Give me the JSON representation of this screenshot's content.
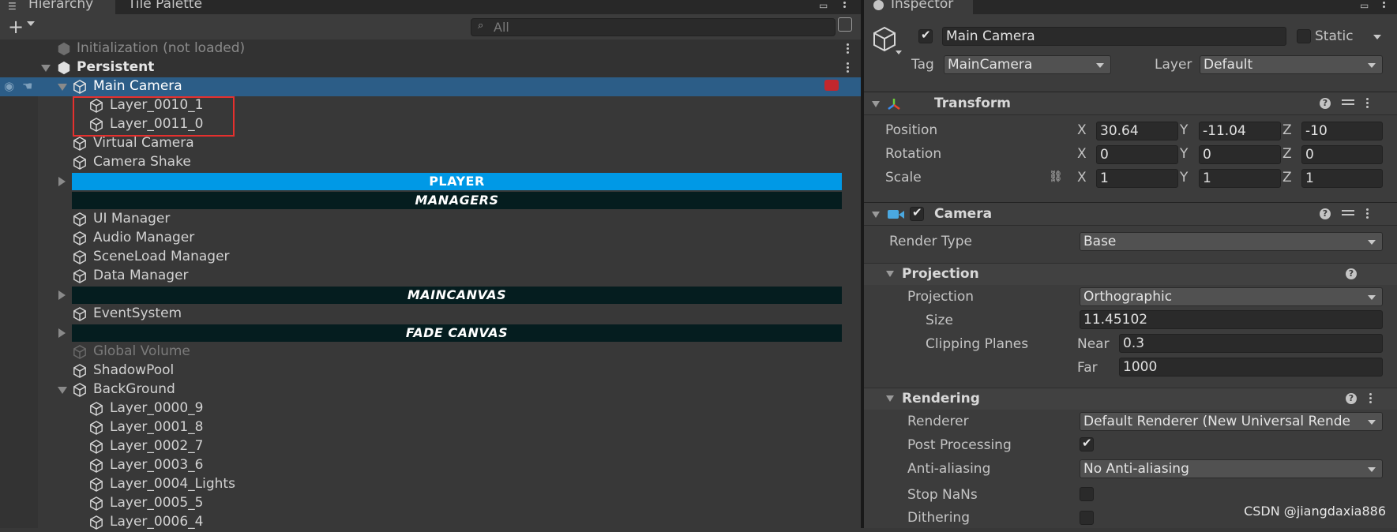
{
  "hierarchy": {
    "tab_label": "Hierarchy",
    "tile_tab_label": "Tile Palette",
    "search_placeholder": "All",
    "scenes": [
      {
        "label": "Initialization (not loaded)"
      },
      {
        "label": "Persistent"
      }
    ],
    "items": [
      {
        "label": "Main Camera"
      },
      {
        "label": "Layer_0010_1"
      },
      {
        "label": "Layer_0011_0"
      },
      {
        "label": "Virtual Camera"
      },
      {
        "label": "Camera Shake"
      },
      {
        "label": "PLAYER"
      },
      {
        "label": "MANAGERS"
      },
      {
        "label": "UI Manager"
      },
      {
        "label": "Audio Manager"
      },
      {
        "label": "SceneLoad Manager"
      },
      {
        "label": "Data Manager"
      },
      {
        "label": "MAINCANVAS"
      },
      {
        "label": "EventSystem"
      },
      {
        "label": "FADE CANVAS"
      },
      {
        "label": "Global Volume"
      },
      {
        "label": "ShadowPool"
      },
      {
        "label": "BackGround"
      },
      {
        "label": "Layer_0000_9"
      },
      {
        "label": "Layer_0001_8"
      },
      {
        "label": "Layer_0002_7"
      },
      {
        "label": "Layer_0003_6"
      },
      {
        "label": "Layer_0004_Lights"
      },
      {
        "label": "Layer_0005_5"
      },
      {
        "label": "Layer_0006_4"
      }
    ]
  },
  "inspector": {
    "tab_label": "Inspector",
    "object_name": "Main Camera",
    "static_label": "Static",
    "tag_label": "Tag",
    "tag_value": "MainCamera",
    "layer_label": "Layer",
    "layer_value": "Default",
    "transform": {
      "title": "Transform",
      "position_label": "Position",
      "rotation_label": "Rotation",
      "scale_label": "Scale",
      "axis_x": "X",
      "axis_y": "Y",
      "axis_z": "Z",
      "position": [
        "30.64",
        "-11.04",
        "-10"
      ],
      "rotation": [
        "0",
        "0",
        "0"
      ],
      "scale": [
        "1",
        "1",
        "1"
      ]
    },
    "camera": {
      "title": "Camera",
      "render_type_label": "Render Type",
      "render_type_value": "Base",
      "projection_section": "Projection",
      "projection_label": "Projection",
      "projection_value": "Orthographic",
      "size_label": "Size",
      "size_value": "11.45102",
      "clipping_label": "Clipping Planes",
      "near_label": "Near",
      "near_value": "0.3",
      "far_label": "Far",
      "far_value": "1000",
      "rendering_section": "Rendering",
      "renderer_label": "Renderer",
      "renderer_value": "Default Renderer (New Universal Rende",
      "post_processing_label": "Post Processing",
      "antialiasing_label": "Anti-aliasing",
      "antialiasing_value": "No Anti-aliasing",
      "stop_nans_label": "Stop NaNs",
      "dithering_label": "Dithering"
    }
  },
  "watermark": "CSDN @jiangdaxia886",
  "colors": {
    "selection": "#2c5d87",
    "player_bar": "#0099e6",
    "dark_bar": "#051d1f",
    "highlight_box": "#e5302e"
  }
}
